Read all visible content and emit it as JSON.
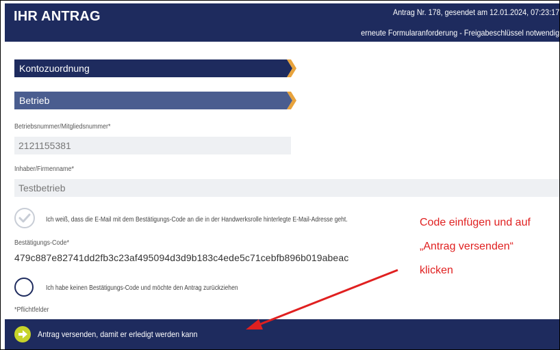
{
  "header": {
    "title": "IHR ANTRAG",
    "meta_line1": "Antrag Nr. 178, gesendet am 12.01.2024, 07:23:17",
    "meta_line2": "erneute Formularanforderung - Freigabeschlüssel notwendig"
  },
  "sections": {
    "konto": "Kontozuordnung",
    "betrieb": "Betrieb"
  },
  "fields": {
    "betriebsnummer_label": "Betriebsnummer/Mitgliedsnummer*",
    "betriebsnummer_value": "2121155381",
    "inhaber_label": "Inhaber/Firmenname*",
    "inhaber_value": "Testbetrieb",
    "email_notice": "Ich weiß, dass die E-Mail mit dem Bestätigungs-Code an die in der Handwerksrolle hinterlegte E-Mail-Adresse geht.",
    "code_label": "Bestätigungs-Code*",
    "code_value": "479c887e82741dd2fb3c23af495094d3d9b183c4ede5c71cebfb896b019abeac",
    "no_code_option": "Ich habe keinen Bestätigungs-Code und möchte den Antrag zurückziehen",
    "required_note": "*Pflichtfelder"
  },
  "footer": {
    "submit_label": "Antrag versenden, damit er erledigt werden kann"
  },
  "annotation": {
    "line1": "Code einfügen und auf",
    "line2": "„Antrag versenden“",
    "line3": "klicken"
  },
  "colors": {
    "navy": "#1e2b5e",
    "section_light": "#4a5d8f",
    "chevron": "#e8a33c",
    "submit_icon": "#c6d32a",
    "annotation": "#e02020"
  },
  "icons": {
    "check": "check-icon",
    "chevron": "chevron-right-icon",
    "submit": "arrow-right-circle-icon"
  }
}
